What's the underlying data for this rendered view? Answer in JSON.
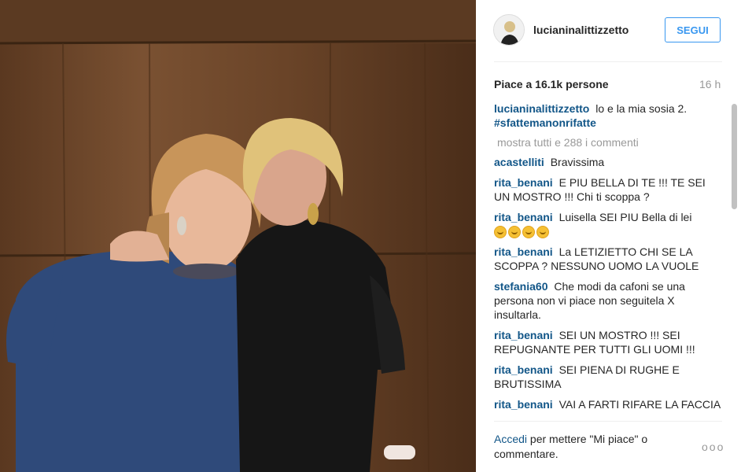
{
  "post": {
    "username": "lucianinalittizzetto",
    "follow_label": "SEGUI",
    "likes_text": "Piace a 16.1k persone",
    "time_ago": "16 h",
    "caption_user": "lucianinalittizzetto",
    "caption_text": "lo e la mia sosia 2.",
    "caption_hashtag": "#sfattemanonrifatte",
    "view_all_text": "mostra tutti e 288 i commenti",
    "comments": [
      {
        "user": "acastelliti",
        "text": "Bravissima"
      },
      {
        "user": "rita_benani",
        "text": "E PIU BELLA DI TE !!! TE SEI UN MOSTRO !!! Chi ti scoppa ?"
      },
      {
        "user": "rita_benani",
        "text": "Luisella SEI PIU Bella di lei"
      },
      {
        "user": "rita_benani",
        "text": "La LETIZIETTO CHI SE LA SCOPPA ? NESSUNO UOMO LA VUOLE"
      },
      {
        "user": "stefania60",
        "text": "Che modi da cafoni se una persona non vi piace non seguitela X insultarla."
      },
      {
        "user": "rita_benani",
        "text": "SEI UN MOSTRO !!! SEI REPUGNANTE PER TUTTI GLI UOMI !!!"
      },
      {
        "user": "rita_benani",
        "text": "SEI PIENA DI RUGHE E BRUTISSIMA"
      },
      {
        "user": "rita_benani",
        "text": "VAI A FARTI RIFARE LA FACCIA E IL CORPO CON I SOLDI CHE"
      }
    ],
    "footer_login": "Accedi",
    "footer_text": "per mettere \"Mi piace\" o commentare.",
    "more_options": "ooo"
  },
  "icons": {
    "emoji": "smiling-face-icon",
    "avatar": "profile-avatar"
  },
  "colors": {
    "accent": "#3897f0",
    "username": "#125688",
    "muted": "#999999",
    "text": "#262626"
  }
}
